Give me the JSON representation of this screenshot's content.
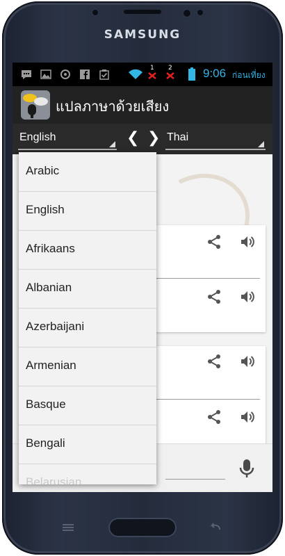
{
  "device": {
    "brand": "SAMSUNG"
  },
  "statusbar": {
    "time": "9:06",
    "ampm": "ก่อนเที่ยง",
    "sim1": "1",
    "sim2": "2",
    "icons": [
      "message-icon",
      "image-icon",
      "settings-icon",
      "facebook-icon",
      "clipboard-check-icon",
      "wifi-icon",
      "no-signal-icon",
      "no-signal-icon",
      "battery-icon"
    ]
  },
  "app": {
    "title": "แปลภาษาด้วยเสียง",
    "icon": "speech-translate-app-icon"
  },
  "language_bar": {
    "source_language": "English",
    "target_language": "Thai",
    "prev_arrow": "❮",
    "next_arrow": "❯"
  },
  "dropdown": {
    "items": [
      "Arabic",
      "English",
      "Afrikaans",
      "Albanian",
      "Azerbaijani",
      "Armenian",
      "Basque",
      "Bengali",
      "Belarusian"
    ]
  },
  "cards": {
    "actions": [
      "share-icon",
      "speaker-icon"
    ]
  },
  "colors": {
    "accent": "#33b5e5",
    "actionbar": "#222222",
    "dropdown_bg": "#f2f2f2"
  }
}
